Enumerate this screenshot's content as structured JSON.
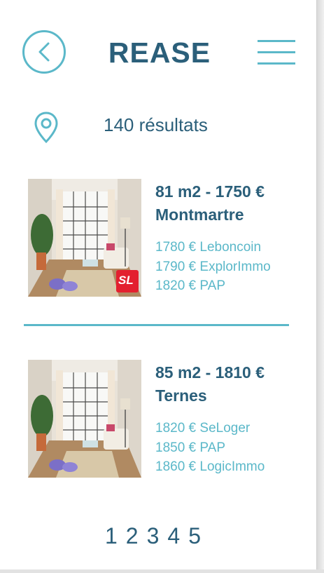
{
  "header": {
    "title": "REASE",
    "back_icon": "chevron-left-icon",
    "menu_icon": "hamburger-menu-icon"
  },
  "search": {
    "location_icon": "map-pin-icon",
    "results_text": "140 résultats"
  },
  "listings": [
    {
      "headline_line1": "81 m2 - 1750 €",
      "headline_line2": "Montmartre",
      "badge": "SL",
      "prices": [
        "1780 € Leboncoin",
        "1790 € ExplorImmo",
        "1820 € PAP"
      ]
    },
    {
      "headline_line1": "85 m2 - 1810 €",
      "headline_line2": "Ternes",
      "prices": [
        "1820 € SeLoger",
        "1850 € PAP",
        "1860 € LogicImmo"
      ]
    }
  ],
  "pagination": [
    "1",
    "2",
    "3",
    "4",
    "5"
  ],
  "colors": {
    "primary": "#2b5f7a",
    "accent": "#5bb8c9",
    "badge": "#e3202f"
  }
}
